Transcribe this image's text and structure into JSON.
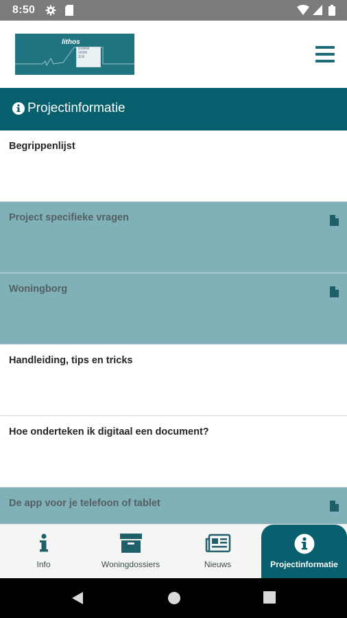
{
  "status_bar": {
    "time": "8:50",
    "icons": [
      "settings-icon",
      "sd-card-icon",
      "wifi-icon",
      "signal-icon",
      "battery-icon"
    ]
  },
  "app_bar": {
    "logo": {
      "brand": "lithos",
      "lines": [
        "DOWNI",
        "VOOR",
        "ZOE"
      ]
    },
    "menu_icon": "hamburger-menu-icon"
  },
  "section": {
    "title": "Projectinformatie",
    "icon": "info-circle-icon"
  },
  "items": [
    {
      "label": "Begrippenlijst",
      "highlighted": false,
      "has_doc_icon": false
    },
    {
      "label": "Project specifieke vragen",
      "highlighted": true,
      "has_doc_icon": true
    },
    {
      "label": "Woningborg",
      "highlighted": true,
      "has_doc_icon": true
    },
    {
      "label": "Handleiding, tips en tricks",
      "highlighted": false,
      "has_doc_icon": false
    },
    {
      "label": "Hoe onderteken ik digitaal een document?",
      "highlighted": false,
      "has_doc_icon": false
    },
    {
      "label": "De app voor je telefoon of tablet",
      "highlighted": true,
      "has_doc_icon": true
    }
  ],
  "bottom_nav": [
    {
      "label": "Info",
      "icon": "info-icon",
      "active": false
    },
    {
      "label": "Woningdossiers",
      "icon": "archive-box-icon",
      "active": false
    },
    {
      "label": "Nieuws",
      "icon": "newspaper-icon",
      "active": false
    },
    {
      "label": "Projectinformatie",
      "icon": "info-circle-icon",
      "active": true
    }
  ],
  "colors": {
    "primary": "#075f6e",
    "highlight_row": "#80b1b8",
    "status_bar": "#7b7b7b",
    "nav_bg": "#f5f5f5"
  }
}
